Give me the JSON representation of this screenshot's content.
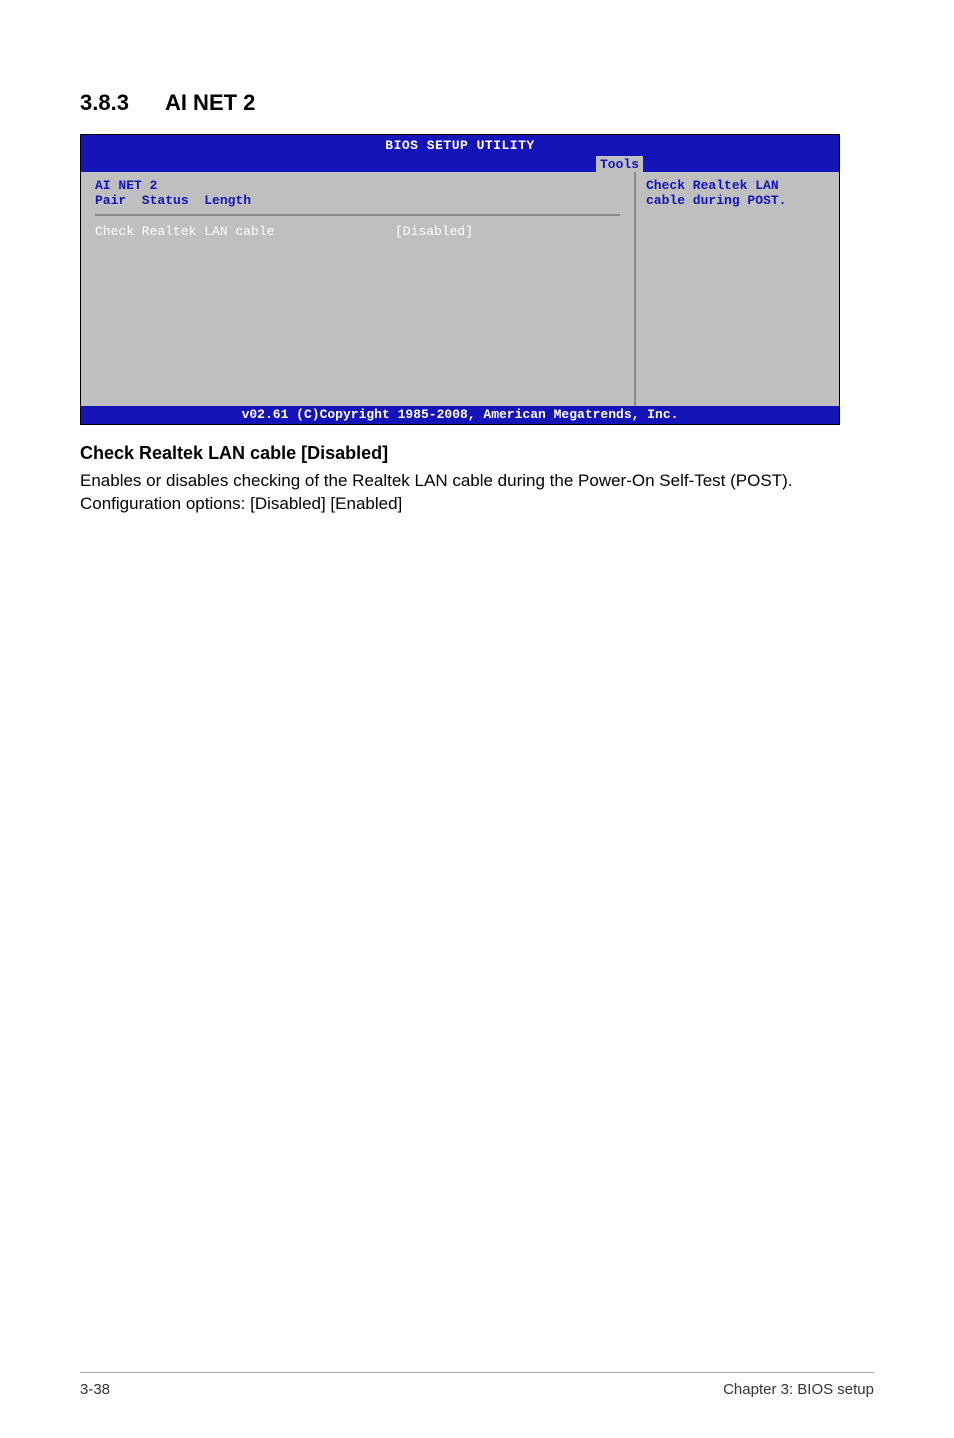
{
  "section": {
    "number": "3.8.3",
    "title": "AI NET 2"
  },
  "bios": {
    "title": "BIOS SETUP UTILITY",
    "tab": "Tools",
    "left_header": "AI NET 2\nPair  Status  Length",
    "option_label": "Check Realtek LAN cable",
    "option_value": "[Disabled]",
    "help_text": "Check Realtek LAN\ncable during POST.",
    "footer": "v02.61 (C)Copyright 1985-2008, American Megatrends, Inc."
  },
  "subheading": "Check Realtek LAN cable [Disabled]",
  "body": "Enables or disables checking of the Realtek LAN cable during the Power-On Self-Test (POST). Configuration options: [Disabled] [Enabled]",
  "footer": {
    "left": "3-38",
    "right": "Chapter 3: BIOS setup"
  }
}
